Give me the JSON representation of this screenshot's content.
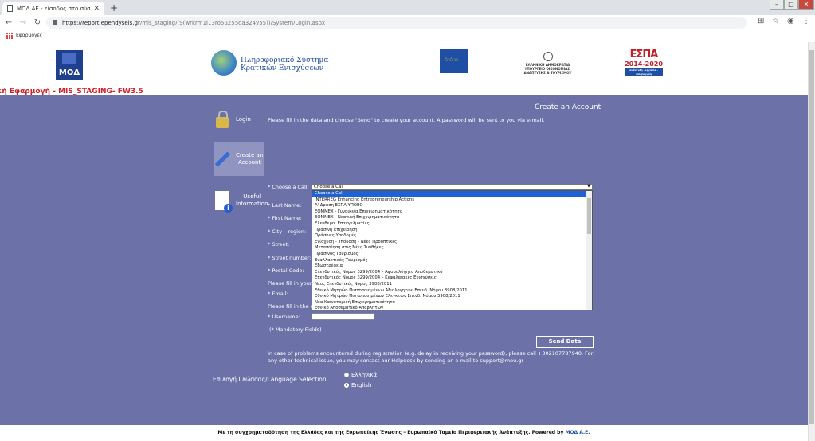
{
  "browser": {
    "tab_title": "ΜΟΔ ΑΕ - είσοδος στο σύστημα",
    "url_host": "https://report.ependyseis.gr",
    "url_path": "/mis_staging/(S(wrkrm1i13ro5u255oa324y55))/System/Login.aspx",
    "bookmarks_label": "Εφαρμογές"
  },
  "header": {
    "moda_logo": "ΜΟΔ",
    "system_title_line1": "Πληροφοριακό Σύστημα",
    "system_title_line2": "Κρατικών Ενισχύσεων",
    "ministry_line1": "ΕΛΛΗΝΙΚΗ ΔΗΜΟΚΡΑΤΙΑ",
    "ministry_line2": "ΥΠΟΥΡΓΕΙΟ ΟΙΚΟΝΟΜΙΑΣ,",
    "ministry_line3": "ΑΝΑΠΤΥΞΗΣ & ΤΟΥΡΙΣΜΟΥ",
    "espa_title": "ΕΣΠΑ",
    "espa_years": "2014-2020",
    "espa_tag": "ανάπτυξη - εργασία - αλληλεγγύη",
    "env_banner": "κή Εφαρμογή - MIS_STAGING- FW3.5"
  },
  "sidebar": {
    "login": "Login",
    "create_line1": "Create an",
    "create_line2": "Account",
    "info_line1": "Useful",
    "info_line2": "Information"
  },
  "form": {
    "heading": "Create an Account",
    "intro": "Please fill in the data and choose \"Send\" to create your account. A password will be sent to you via e-mail.",
    "choose_call_label": "* Choose a Call:",
    "choose_call_value": "Choose a Call",
    "last_name_label": "* Last Name:",
    "first_name_label": "* First Name:",
    "city_label": "* City – region:",
    "street_label": "* Street:",
    "street_number_label": "* Street number:",
    "postal_code_label": "* Postal Code:",
    "fill_email_partial": "Please fill in your e",
    "email_label": "* Email:",
    "fill_username_partial": "Please fill in the us",
    "username_label": "* Username:",
    "mandatory": "(*  Mandatory Fields)",
    "send_button": "Send Data",
    "help_text": "In case of problems encountered during registration (e.g. delay in receiving your password), please call +302107787940. For any other technical issue, you may contact our Helpdesk by sending an e-mail to support@mou.gr"
  },
  "call_options": [
    "Choose a Call",
    "INTERREG Enhancing Entrepreneurship Actions",
    "Α' Δράση ΕΣΠΑ ΥΠΟΕΟ",
    "ΕΟΜΜΕΧ - Γυναικεία Επιχειρηματικότητα",
    "ΕΟΜΜΕΧ - Νεανική Επιχειρηματικότητα",
    "Ελεύθεροι Επαγγελματίες",
    "Πράσινη Επιχείρηση",
    "Πράσινες Υποδομές",
    "Ενίσχυση - Υπόδοση - Νέες Προοπτικές",
    "Μεταποίηση στις Νέες Συνθήκες",
    "Πράσινος Τουρισμός",
    "Εναλλακτικός Τουρισμός",
    "Εξωστρέφεια",
    "Επενδυτικός Νόμος 3299/2004 – Αφορολόγητο Αποθεματικό",
    "Επενδυτικός Νόμος 3299/2004 – Κεφαλαιακές Ενισχύσεις",
    "Νέος Επενδυτικός Νόμος 3908/2011",
    "Εθνικό Μητρώο Πιστοποιημένων Αξιολογητών Επενδ. Νόμου 3908/2011",
    "Εθνικό Μητρώο Πιστοποιημένων Ελεγκτών Επενδ. Νόμου 3908/2011",
    "Νέα Καινοτομική Επιχειρηματικότητα",
    "Εθνικό Αποθεματικό Αποβλήτων"
  ],
  "language": {
    "label": "Επιλογή Γλώσσας/Language Selection",
    "greek": "Ελληνικά",
    "english": "English",
    "selected": "English"
  },
  "footer": {
    "text": "Με τη συγχρηματοδότηση της Ελλάδας και της Ευρωπαϊκής Ένωσης – Ευρωπαϊκό Ταμείο Περιφερειακής Ανάπτυξης.  Powered by ",
    "brand": "ΜΟΔ Α.Ε."
  },
  "colors": {
    "page_bg": "#6c72a8",
    "banner_red": "#d0202a",
    "select_highlight": "#1e63d6"
  }
}
